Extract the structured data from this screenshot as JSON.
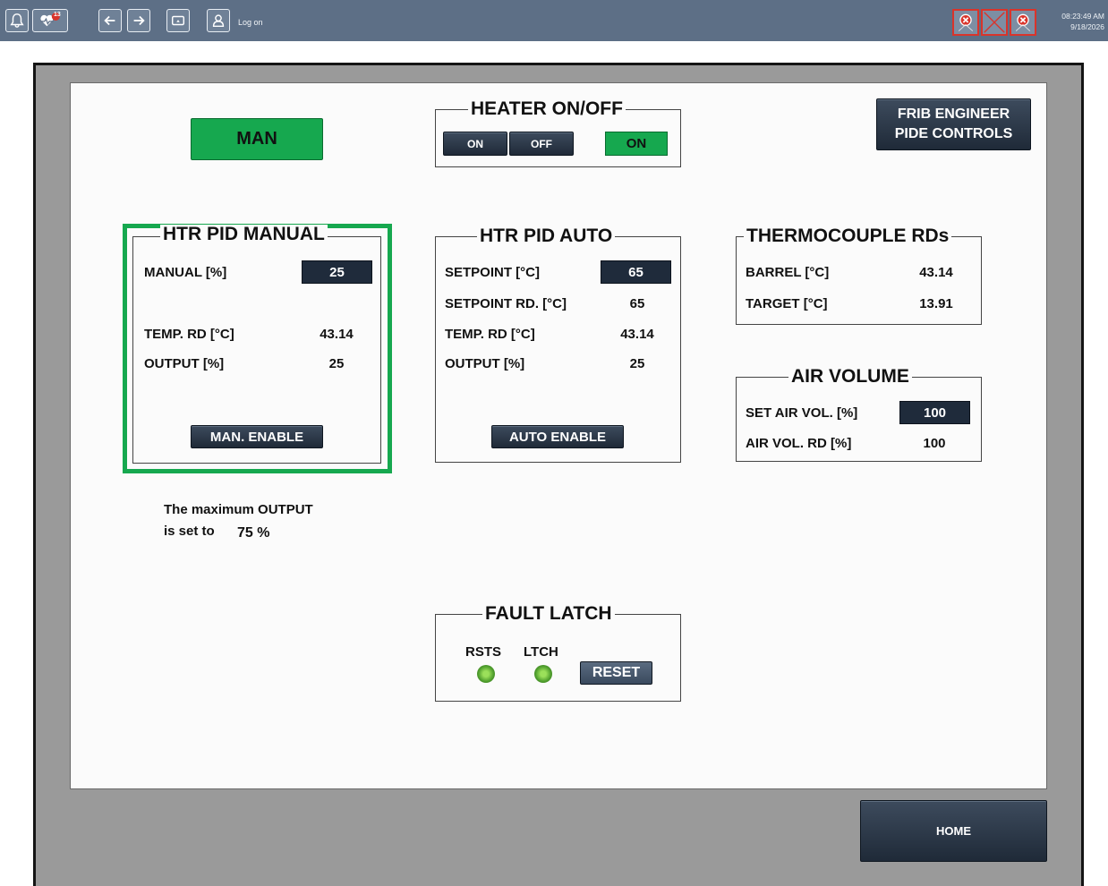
{
  "toolbar": {
    "logon_label": "Log on",
    "notification_badge": "13",
    "clock_time": "08:23:49 AM",
    "clock_date": "9/18/2026",
    "bg_color": "#5d6f86"
  },
  "mode_indicator": "MAN",
  "heater": {
    "title": "HEATER ON/OFF",
    "on_label": "ON",
    "off_label": "OFF",
    "status": "ON"
  },
  "frib_button": {
    "line1": "FRIB ENGINEER",
    "line2": "PIDE CONTROLS"
  },
  "manual": {
    "title": "HTR PID MANUAL",
    "manual_label": "MANUAL [%]",
    "manual_value": "25",
    "temp_label": "TEMP. RD [°C]",
    "temp_value": "43.14",
    "output_label": "OUTPUT [%]",
    "output_value": "25",
    "enable_label": "MAN. ENABLE"
  },
  "auto": {
    "title": "HTR PID AUTO",
    "setpoint_label": "SETPOINT [°C]",
    "setpoint_value": "65",
    "setpoint_rd_label": "SETPOINT RD. [°C]",
    "setpoint_rd_value": "65",
    "temp_label": "TEMP. RD [°C]",
    "temp_value": "43.14",
    "output_label": "OUTPUT [%]",
    "output_value": "25",
    "enable_label": "AUTO ENABLE"
  },
  "thermocouple": {
    "title": "THERMOCOUPLE RDs",
    "barrel_label": "BARREL [°C]",
    "barrel_value": "43.14",
    "target_label": "TARGET [°C]",
    "target_value": "13.91"
  },
  "air": {
    "title": "AIR VOLUME",
    "set_label": "SET AIR VOL. [%]",
    "set_value": "100",
    "rd_label": "AIR VOL. RD [%]",
    "rd_value": "100"
  },
  "max_output": {
    "line1": "The maximum OUTPUT",
    "line2_prefix": "is set to",
    "value": "75 %"
  },
  "fault": {
    "title": "FAULT LATCH",
    "rsts_label": "RSTS",
    "ltch_label": "LTCH",
    "reset_label": "RESET"
  },
  "home_label": "HOME",
  "colors": {
    "active_green": "#16a84f",
    "dark_button": "#1f2a38",
    "frame_gray": "#9a9a9a"
  }
}
